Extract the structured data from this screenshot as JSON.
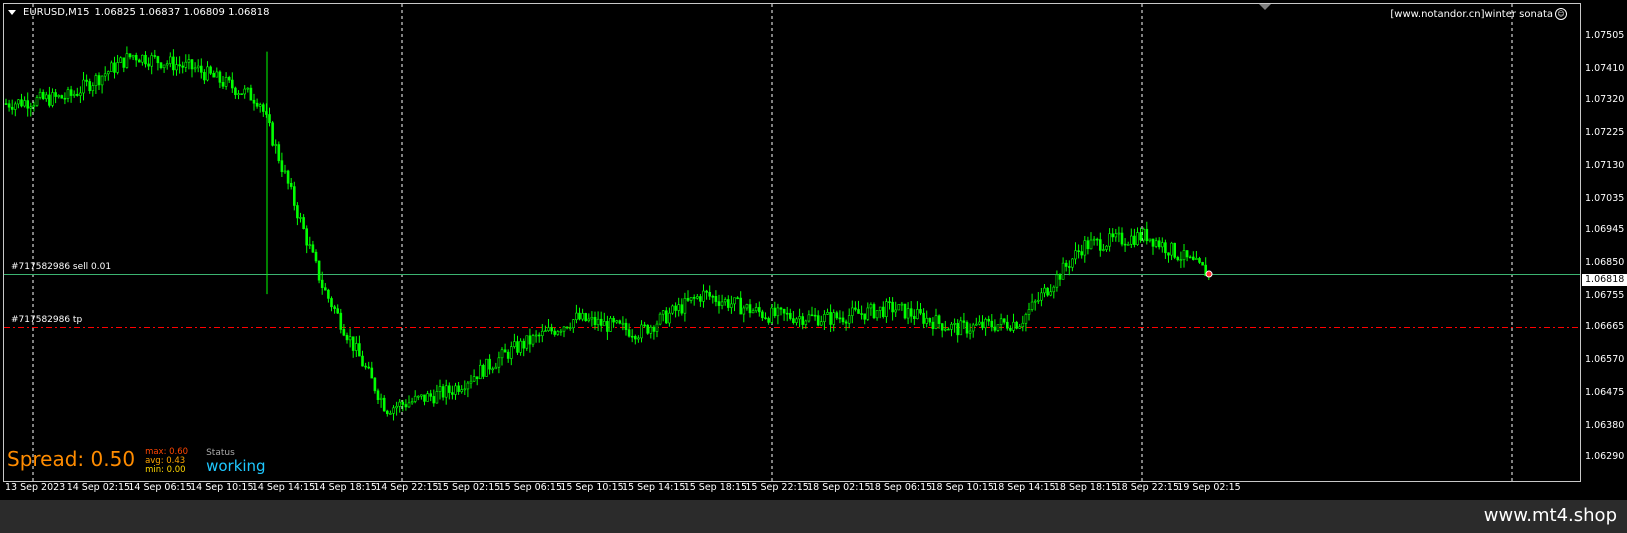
{
  "header": {
    "symbol": "EURUSD,M15",
    "prices": "1.06825 1.06837 1.06809 1.06818"
  },
  "vendor": {
    "label": "[www.notandor.cn]winter sonata",
    "icon": "smiley-icon"
  },
  "price_axis": [
    "1.07505",
    "1.07410",
    "1.07320",
    "1.07225",
    "1.07130",
    "1.07035",
    "1.06945",
    "1.06850",
    "1.06755",
    "1.06665",
    "1.06570",
    "1.06475",
    "1.06380",
    "1.06290"
  ],
  "current_price": "1.06818",
  "time_axis": [
    "13 Sep 2023",
    "14 Sep 02:15",
    "14 Sep 06:15",
    "14 Sep 10:15",
    "14 Sep 14:15",
    "14 Sep 18:15",
    "14 Sep 22:15",
    "15 Sep 02:15",
    "15 Sep 06:15",
    "15 Sep 10:15",
    "15 Sep 14:15",
    "15 Sep 18:15",
    "15 Sep 22:15",
    "18 Sep 02:15",
    "18 Sep 06:15",
    "18 Sep 10:15",
    "18 Sep 14:15",
    "18 Sep 18:15",
    "18 Sep 22:15",
    "19 Sep 02:15"
  ],
  "orders": [
    {
      "label": "#717582986 sell 0.01",
      "price": 1.06818,
      "color": "#3cb371"
    },
    {
      "label": "#717582986 tp",
      "price": 1.06665,
      "color": "#ff0000"
    }
  ],
  "spread": {
    "text": "Spread: 0.50",
    "max": "max: 0.60",
    "avg": "avg: 0.43",
    "min": "min: 0.00"
  },
  "status": {
    "label": "Status",
    "value": "working"
  },
  "colors": {
    "candle": "#00ff00",
    "background": "#000000",
    "grid": "#ffffff",
    "spread": "#ff8c00",
    "status": "#1ec8ff"
  },
  "watermark": "www.mt4.shop",
  "chart_data": {
    "type": "line",
    "series": [],
    "x": [
      "13 Sep 2023",
      "14 Sep 02:15",
      "14 Sep 06:15",
      "14 Sep 10:15",
      "14 Sep 14:15",
      "14 Sep 18:15",
      "14 Sep 22:15",
      "15 Sep 02:15",
      "15 Sep 06:15",
      "15 Sep 10:15",
      "15 Sep 14:15",
      "15 Sep 18:15",
      "15 Sep 22:15",
      "18 Sep 02:15",
      "18 Sep 06:15",
      "18 Sep 10:15",
      "18 Sep 14:15",
      "18 Sep 18:15",
      "18 Sep 22:15",
      "19 Sep 02:15"
    ],
    "close": [
      1.0731,
      1.0733,
      1.0745,
      1.0741,
      1.0732,
      1.0678,
      1.0643,
      1.0648,
      1.066,
      1.0669,
      1.0665,
      1.0676,
      1.067,
      1.0669,
      1.0672,
      1.0666,
      1.0668,
      1.069,
      1.0693,
      1.06818
    ],
    "ylim": [
      1.0629,
      1.07505
    ],
    "grid": true
  }
}
